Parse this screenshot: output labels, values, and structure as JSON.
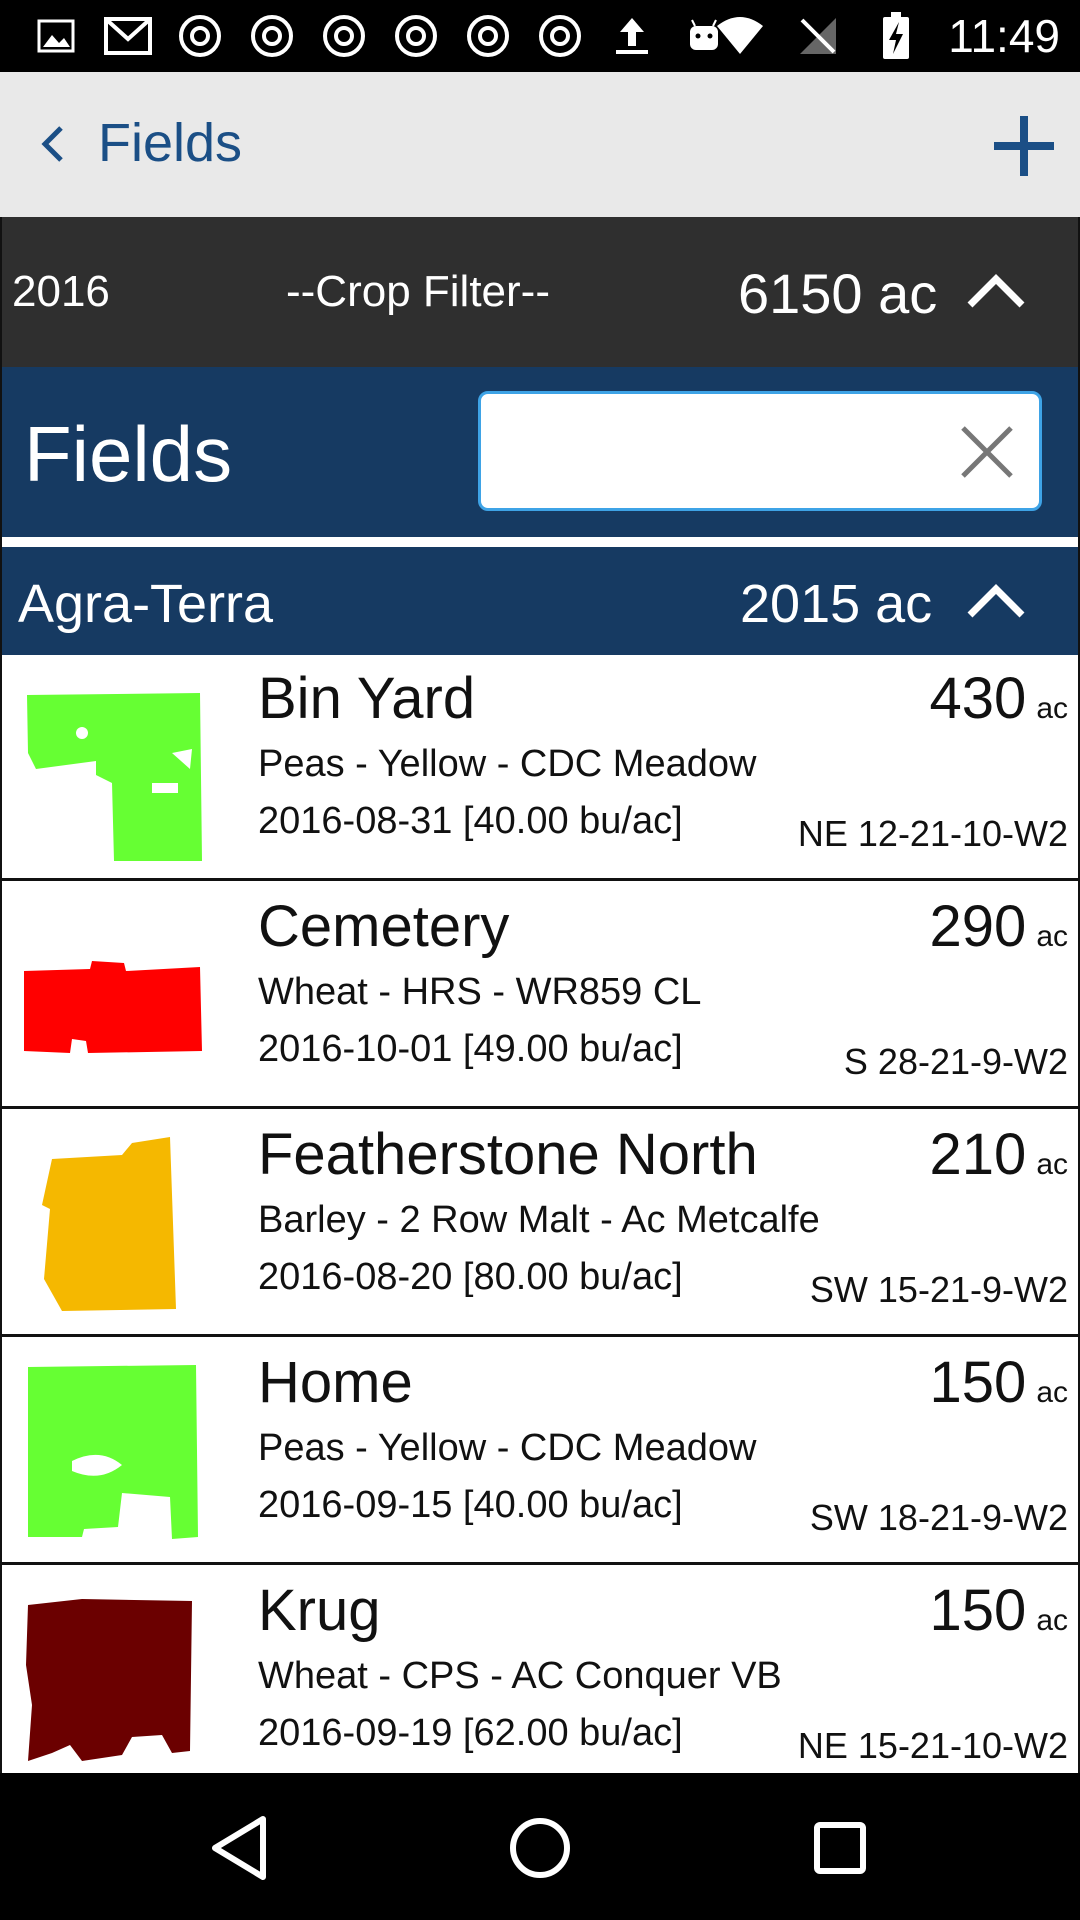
{
  "status_bar": {
    "time": "11:49",
    "icons": [
      "image-icon",
      "gmail-icon",
      "chrome-icon",
      "chrome-icon",
      "chrome-icon",
      "chrome-icon",
      "chrome-icon",
      "chrome-icon",
      "upload-icon",
      "android-icon",
      "wifi-icon",
      "no-signal-icon",
      "battery-charging-icon"
    ]
  },
  "app_bar": {
    "title": "Fields"
  },
  "filter": {
    "year": "2016",
    "crop_filter": "--Crop Filter--",
    "total_area": "6150 ac"
  },
  "fields_header": {
    "title": "Fields",
    "search_placeholder": "",
    "search_value": ""
  },
  "farm": {
    "name": "Agra-Terra",
    "area": "2015 ac"
  },
  "fields": [
    {
      "name": "Bin Yard",
      "crop": "Peas - Yellow - CDC Meadow",
      "harvest": "2016-08-31 [40.00 bu/ac]",
      "area": "430",
      "unit": "ac",
      "legal": "NE 12-21-10-W2",
      "color": "#66ff33"
    },
    {
      "name": "Cemetery",
      "crop": "Wheat - HRS - WR859 CL",
      "harvest": "2016-10-01 [49.00 bu/ac]",
      "area": "290",
      "unit": "ac",
      "legal": "S 28-21-9-W2",
      "color": "#ff0000"
    },
    {
      "name": "Featherstone North",
      "crop": "Barley - 2 Row Malt - Ac Metcalfe",
      "harvest": "2016-08-20 [80.00 bu/ac]",
      "area": "210",
      "unit": "ac",
      "legal": "SW 15-21-9-W2",
      "color": "#f5b800"
    },
    {
      "name": "Home",
      "crop": "Peas - Yellow - CDC Meadow",
      "harvest": "2016-09-15 [40.00 bu/ac]",
      "area": "150",
      "unit": "ac",
      "legal": "SW 18-21-9-W2",
      "color": "#66ff33"
    },
    {
      "name": "Krug",
      "crop": "Wheat - CPS - AC Conquer VB",
      "harvest": "2016-09-19 [62.00 bu/ac]",
      "area": "150",
      "unit": "ac",
      "legal": "NE 15-21-10-W2",
      "color": "#6b0000"
    }
  ],
  "colors": {
    "accent": "#1b4f86",
    "header_blue": "#163a62",
    "filter_bg": "#2f2f2f",
    "search_border": "#3ea3e6"
  }
}
